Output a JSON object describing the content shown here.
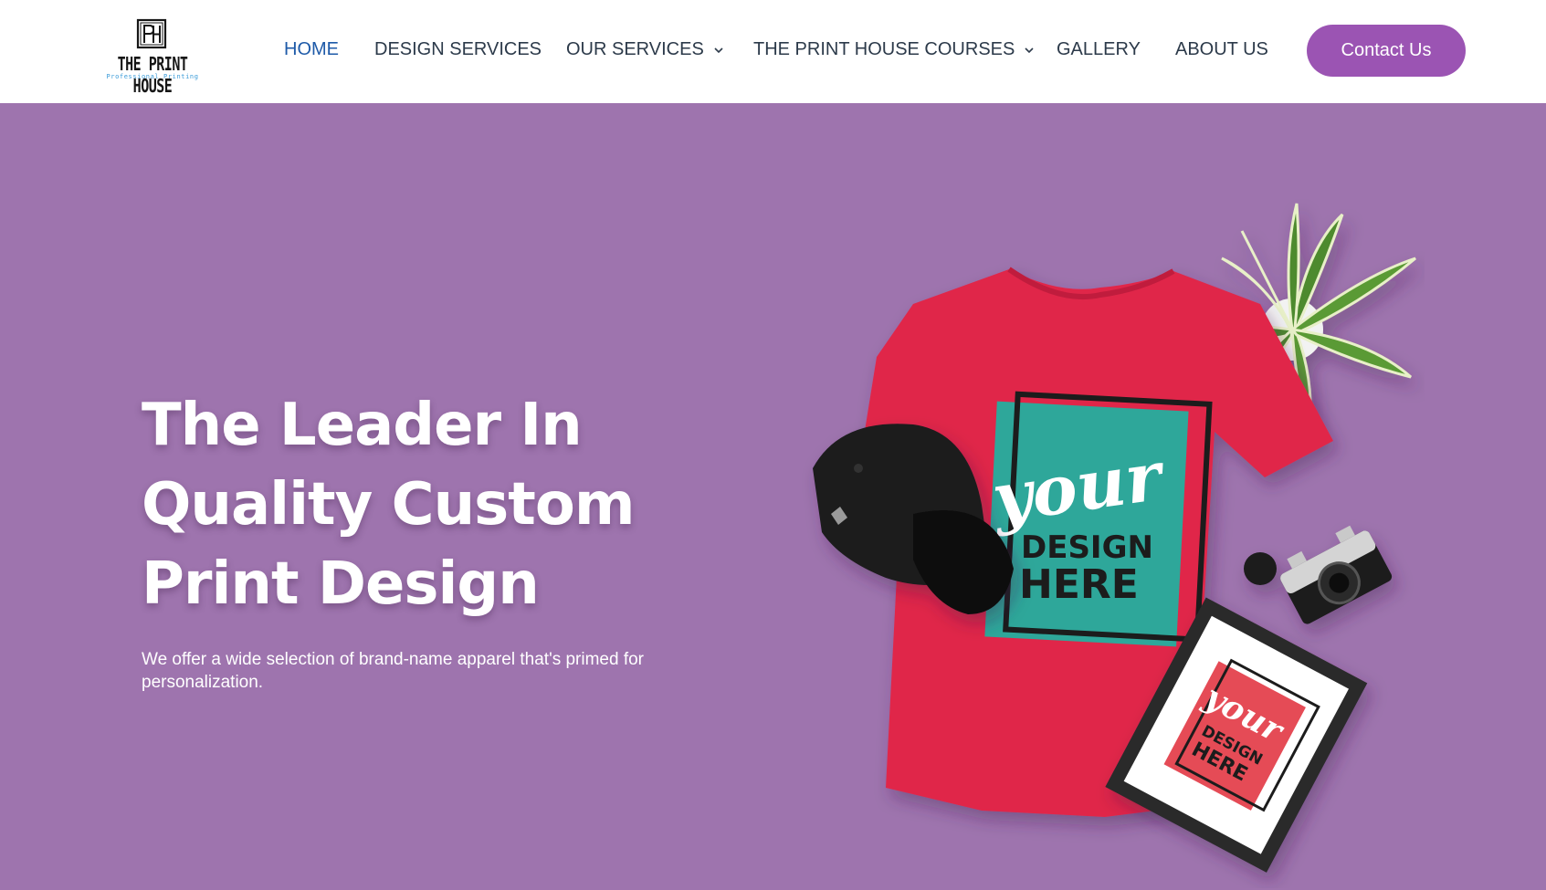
{
  "brand": {
    "logo_monogram": "PH",
    "logo_name": "THE PRINT HOUSE",
    "logo_tagline": "Professional Printing"
  },
  "nav": {
    "items": [
      {
        "label": "HOME",
        "active": true,
        "has_dropdown": false
      },
      {
        "label": "DESIGN SERVICES",
        "active": false,
        "has_dropdown": false
      },
      {
        "label": "OUR SERVICES",
        "active": false,
        "has_dropdown": true
      },
      {
        "label": "THE PRINT HOUSE COURSES",
        "active": false,
        "has_dropdown": true
      },
      {
        "label": "GALLERY",
        "active": false,
        "has_dropdown": false
      },
      {
        "label": "ABOUT US",
        "active": false,
        "has_dropdown": false
      }
    ],
    "cta_label": "Contact Us"
  },
  "hero": {
    "headline_lines": [
      "The Leader In",
      "Quality Custom",
      "Print Design"
    ],
    "subtext": "We offer a wide selection of brand-name apparel that's primed for personalization.",
    "shirt_print": {
      "script": "your",
      "line1": "DESIGN",
      "line2": "HERE"
    },
    "frame_print": {
      "script": "your",
      "line1": "DESIGN",
      "line2": "HERE"
    }
  },
  "colors": {
    "hero_background": "#9e74ae",
    "cta_background": "#9b54b3",
    "nav_text": "#2c3a4a",
    "nav_active": "#1e5aa8",
    "shirt": "#e0274a",
    "print_teal": "#2fa79a"
  },
  "icons": {
    "dropdown": "chevron-down-icon",
    "camera": "camera-icon",
    "plant": "plant-icon",
    "cap": "cap-icon"
  }
}
